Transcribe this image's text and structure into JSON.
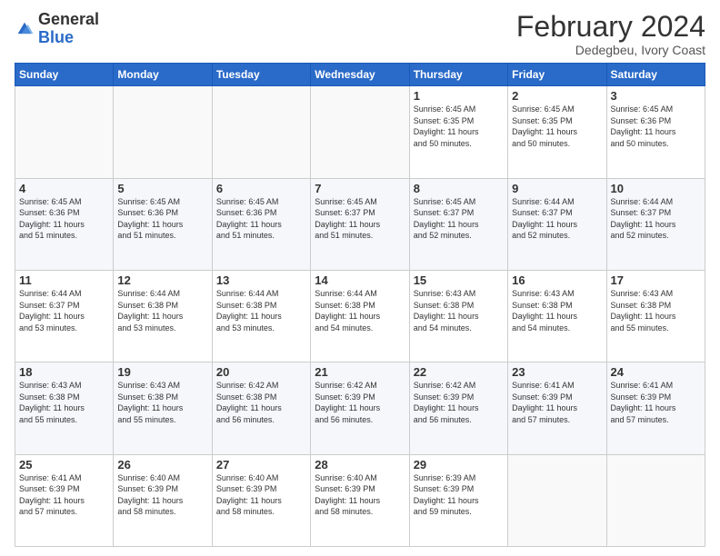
{
  "header": {
    "logo_general": "General",
    "logo_blue": "Blue",
    "month_title": "February 2024",
    "subtitle": "Dedegbeu, Ivory Coast"
  },
  "days_of_week": [
    "Sunday",
    "Monday",
    "Tuesday",
    "Wednesday",
    "Thursday",
    "Friday",
    "Saturday"
  ],
  "weeks": [
    [
      {
        "day": "",
        "info": ""
      },
      {
        "day": "",
        "info": ""
      },
      {
        "day": "",
        "info": ""
      },
      {
        "day": "",
        "info": ""
      },
      {
        "day": "1",
        "info": "Sunrise: 6:45 AM\nSunset: 6:35 PM\nDaylight: 11 hours\nand 50 minutes."
      },
      {
        "day": "2",
        "info": "Sunrise: 6:45 AM\nSunset: 6:35 PM\nDaylight: 11 hours\nand 50 minutes."
      },
      {
        "day": "3",
        "info": "Sunrise: 6:45 AM\nSunset: 6:36 PM\nDaylight: 11 hours\nand 50 minutes."
      }
    ],
    [
      {
        "day": "4",
        "info": "Sunrise: 6:45 AM\nSunset: 6:36 PM\nDaylight: 11 hours\nand 51 minutes."
      },
      {
        "day": "5",
        "info": "Sunrise: 6:45 AM\nSunset: 6:36 PM\nDaylight: 11 hours\nand 51 minutes."
      },
      {
        "day": "6",
        "info": "Sunrise: 6:45 AM\nSunset: 6:36 PM\nDaylight: 11 hours\nand 51 minutes."
      },
      {
        "day": "7",
        "info": "Sunrise: 6:45 AM\nSunset: 6:37 PM\nDaylight: 11 hours\nand 51 minutes."
      },
      {
        "day": "8",
        "info": "Sunrise: 6:45 AM\nSunset: 6:37 PM\nDaylight: 11 hours\nand 52 minutes."
      },
      {
        "day": "9",
        "info": "Sunrise: 6:44 AM\nSunset: 6:37 PM\nDaylight: 11 hours\nand 52 minutes."
      },
      {
        "day": "10",
        "info": "Sunrise: 6:44 AM\nSunset: 6:37 PM\nDaylight: 11 hours\nand 52 minutes."
      }
    ],
    [
      {
        "day": "11",
        "info": "Sunrise: 6:44 AM\nSunset: 6:37 PM\nDaylight: 11 hours\nand 53 minutes."
      },
      {
        "day": "12",
        "info": "Sunrise: 6:44 AM\nSunset: 6:38 PM\nDaylight: 11 hours\nand 53 minutes."
      },
      {
        "day": "13",
        "info": "Sunrise: 6:44 AM\nSunset: 6:38 PM\nDaylight: 11 hours\nand 53 minutes."
      },
      {
        "day": "14",
        "info": "Sunrise: 6:44 AM\nSunset: 6:38 PM\nDaylight: 11 hours\nand 54 minutes."
      },
      {
        "day": "15",
        "info": "Sunrise: 6:43 AM\nSunset: 6:38 PM\nDaylight: 11 hours\nand 54 minutes."
      },
      {
        "day": "16",
        "info": "Sunrise: 6:43 AM\nSunset: 6:38 PM\nDaylight: 11 hours\nand 54 minutes."
      },
      {
        "day": "17",
        "info": "Sunrise: 6:43 AM\nSunset: 6:38 PM\nDaylight: 11 hours\nand 55 minutes."
      }
    ],
    [
      {
        "day": "18",
        "info": "Sunrise: 6:43 AM\nSunset: 6:38 PM\nDaylight: 11 hours\nand 55 minutes."
      },
      {
        "day": "19",
        "info": "Sunrise: 6:43 AM\nSunset: 6:38 PM\nDaylight: 11 hours\nand 55 minutes."
      },
      {
        "day": "20",
        "info": "Sunrise: 6:42 AM\nSunset: 6:38 PM\nDaylight: 11 hours\nand 56 minutes."
      },
      {
        "day": "21",
        "info": "Sunrise: 6:42 AM\nSunset: 6:39 PM\nDaylight: 11 hours\nand 56 minutes."
      },
      {
        "day": "22",
        "info": "Sunrise: 6:42 AM\nSunset: 6:39 PM\nDaylight: 11 hours\nand 56 minutes."
      },
      {
        "day": "23",
        "info": "Sunrise: 6:41 AM\nSunset: 6:39 PM\nDaylight: 11 hours\nand 57 minutes."
      },
      {
        "day": "24",
        "info": "Sunrise: 6:41 AM\nSunset: 6:39 PM\nDaylight: 11 hours\nand 57 minutes."
      }
    ],
    [
      {
        "day": "25",
        "info": "Sunrise: 6:41 AM\nSunset: 6:39 PM\nDaylight: 11 hours\nand 57 minutes."
      },
      {
        "day": "26",
        "info": "Sunrise: 6:40 AM\nSunset: 6:39 PM\nDaylight: 11 hours\nand 58 minutes."
      },
      {
        "day": "27",
        "info": "Sunrise: 6:40 AM\nSunset: 6:39 PM\nDaylight: 11 hours\nand 58 minutes."
      },
      {
        "day": "28",
        "info": "Sunrise: 6:40 AM\nSunset: 6:39 PM\nDaylight: 11 hours\nand 58 minutes."
      },
      {
        "day": "29",
        "info": "Sunrise: 6:39 AM\nSunset: 6:39 PM\nDaylight: 11 hours\nand 59 minutes."
      },
      {
        "day": "",
        "info": ""
      },
      {
        "day": "",
        "info": ""
      }
    ]
  ]
}
